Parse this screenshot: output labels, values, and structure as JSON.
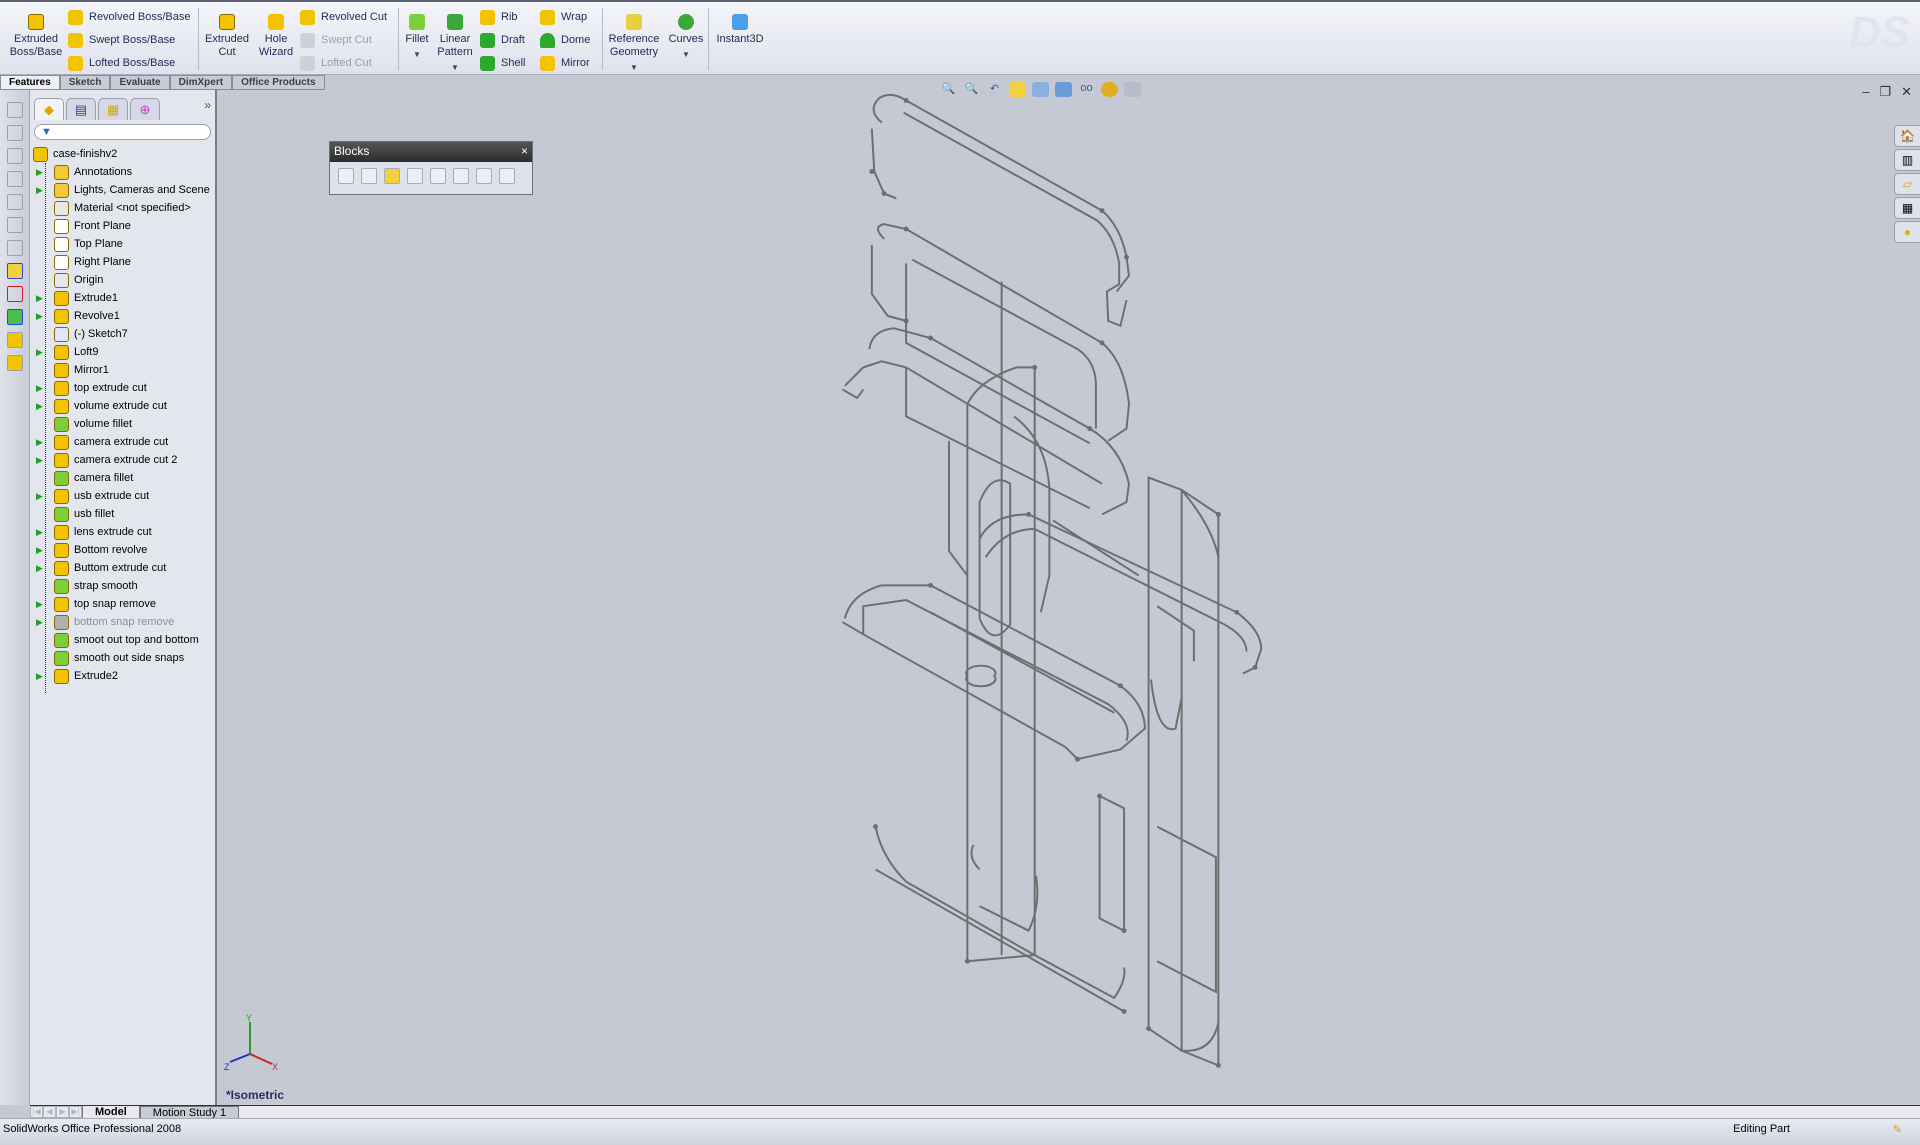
{
  "toolbar": {
    "extruded_boss": "Extruded Boss/Base",
    "revolved_boss": "Revolved Boss/Base",
    "swept_boss": "Swept Boss/Base",
    "lofted_boss": "Lofted Boss/Base",
    "extruded_cut": "Extruded Cut",
    "hole_wizard": "Hole Wizard",
    "revolved_cut": "Revolved Cut",
    "swept_cut": "Swept Cut",
    "lofted_cut": "Lofted Cut",
    "fillet": "Fillet",
    "linear_pattern": "Linear Pattern",
    "rib": "Rib",
    "draft": "Draft",
    "shell": "Shell",
    "wrap": "Wrap",
    "dome": "Dome",
    "mirror": "Mirror",
    "reference_geometry": "Reference Geometry",
    "curves": "Curves",
    "instant3d": "Instant3D"
  },
  "tabs": [
    "Features",
    "Sketch",
    "Evaluate",
    "DimXpert",
    "Office Products"
  ],
  "tree": {
    "root": "case-finishv2",
    "items": [
      {
        "label": "Annotations",
        "exp": true,
        "icon": "annotations-folder-icon",
        "color": "#f3c93a"
      },
      {
        "label": "Lights, Cameras and Scene",
        "exp": true,
        "icon": "lights-folder-icon",
        "color": "#f3c93a"
      },
      {
        "label": "Material <not specified>",
        "exp": false,
        "icon": "material-icon",
        "color": "#e8e8e8"
      },
      {
        "label": "Front Plane",
        "exp": false,
        "icon": "plane-icon",
        "color": "#ffffff"
      },
      {
        "label": "Top Plane",
        "exp": false,
        "icon": "plane-icon",
        "color": "#ffffff"
      },
      {
        "label": "Right Plane",
        "exp": false,
        "icon": "plane-icon",
        "color": "#ffffff"
      },
      {
        "label": "Origin",
        "exp": false,
        "icon": "origin-icon",
        "color": "#e4e6ee"
      },
      {
        "label": "Extrude1",
        "exp": true,
        "icon": "extrude-icon",
        "color": "#f2c400"
      },
      {
        "label": "Revolve1",
        "exp": true,
        "icon": "revolve-icon",
        "color": "#f2c400"
      },
      {
        "label": "(-) Sketch7",
        "exp": false,
        "icon": "sketch-icon",
        "color": "#dfe6ff"
      },
      {
        "label": "Loft9",
        "exp": true,
        "icon": "loft-icon",
        "color": "#f2c400"
      },
      {
        "label": "Mirror1",
        "exp": false,
        "icon": "mirror-icon",
        "color": "#f2c400"
      },
      {
        "label": "top extrude cut",
        "exp": true,
        "icon": "extrude-cut-icon",
        "color": "#f2c400"
      },
      {
        "label": "volume extrude cut",
        "exp": true,
        "icon": "extrude-cut-icon",
        "color": "#f2c400"
      },
      {
        "label": "volume fillet",
        "exp": false,
        "icon": "fillet-icon",
        "color": "#7ccf3a"
      },
      {
        "label": "camera extrude cut",
        "exp": true,
        "icon": "extrude-cut-icon",
        "color": "#f2c400"
      },
      {
        "label": "camera extrude cut 2",
        "exp": true,
        "icon": "extrude-cut-icon",
        "color": "#f2c400"
      },
      {
        "label": "camera fillet",
        "exp": false,
        "icon": "fillet-icon",
        "color": "#7ccf3a"
      },
      {
        "label": "usb extrude cut",
        "exp": true,
        "icon": "extrude-cut-icon",
        "color": "#f2c400"
      },
      {
        "label": "usb fillet",
        "exp": false,
        "icon": "fillet-icon",
        "color": "#7ccf3a"
      },
      {
        "label": "lens extrude cut",
        "exp": true,
        "icon": "extrude-cut-icon",
        "color": "#f2c400"
      },
      {
        "label": "Bottom revolve",
        "exp": true,
        "icon": "revolve-icon",
        "color": "#f2c400"
      },
      {
        "label": "Buttom extrude cut",
        "exp": true,
        "icon": "extrude-cut-icon",
        "color": "#f2c400"
      },
      {
        "label": "strap smooth",
        "exp": false,
        "icon": "fillet-icon",
        "color": "#7ccf3a"
      },
      {
        "label": "top snap remove",
        "exp": true,
        "icon": "extrude-cut-icon",
        "color": "#f2c400"
      },
      {
        "label": "bottom snap remove",
        "exp": true,
        "icon": "extrude-cut-icon",
        "color": "#b0b0b0",
        "suppressed": true
      },
      {
        "label": "smoot out top and bottom",
        "exp": false,
        "icon": "fillet-icon",
        "color": "#7ccf3a"
      },
      {
        "label": "smooth out side snaps",
        "exp": false,
        "icon": "fillet-icon",
        "color": "#7ccf3a"
      },
      {
        "label": "Extrude2",
        "exp": true,
        "icon": "extrude-icon",
        "color": "#f2c400"
      }
    ]
  },
  "blocks": {
    "title": "Blocks",
    "close": "×"
  },
  "viewport": {
    "view_name": "*Isometric",
    "triad": {
      "x": "X",
      "y": "Y",
      "z": "Z"
    }
  },
  "bottom_tabs": [
    "Model",
    "Motion Study 1"
  ],
  "status": {
    "left": "SolidWorks Office Professional 2008",
    "right": "Editing Part"
  },
  "colors": {
    "viewport": "#c5c9d3",
    "wire": "#6e6e6e",
    "accent": "#1d2a55"
  }
}
